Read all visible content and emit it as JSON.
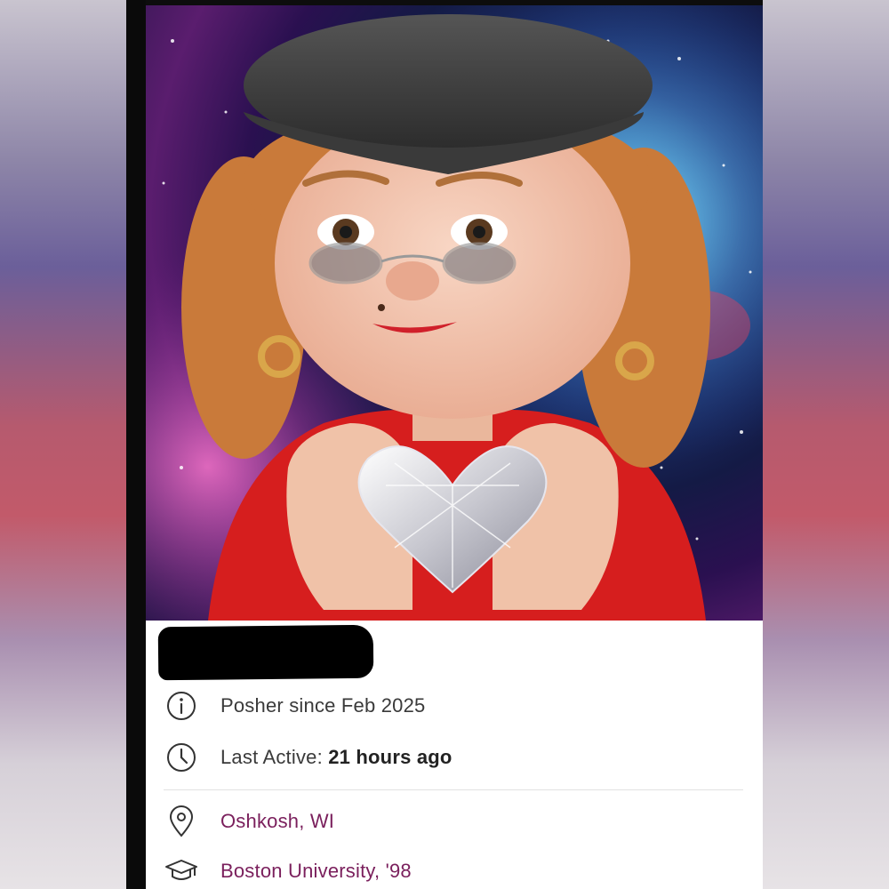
{
  "profile": {
    "posher_since": "Posher since Feb 2025",
    "last_active_label": "Last Active:",
    "last_active_value": "21 hours ago",
    "location": "Oshkosh, WI",
    "education": "Boston University, '98"
  },
  "icons": {
    "info": "info-icon",
    "clock": "clock-icon",
    "location": "location-pin-icon",
    "education": "graduation-cap-icon"
  },
  "colors": {
    "link": "#7a1f5c",
    "text": "#3a3a3a"
  }
}
